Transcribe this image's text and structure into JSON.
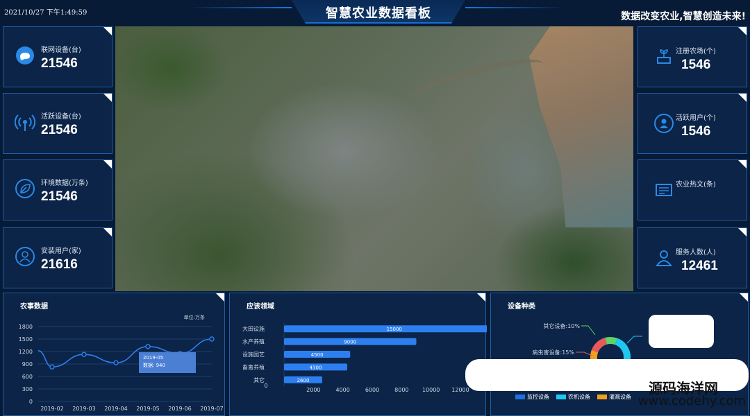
{
  "header": {
    "datetime": "2021/10/27 下午1:49:59",
    "title": "智慧农业数据看板",
    "slogan": "数据改变农业,智慧创造未来!"
  },
  "left_cards": [
    {
      "label": "联网设备(台)",
      "value": "21546",
      "icon": "cloud-chat-icon"
    },
    {
      "label": "活跃设备(台)",
      "value": "21546",
      "icon": "signal-tower-icon"
    },
    {
      "label": "环境数据(万条)",
      "value": "21546",
      "icon": "leaf-icon"
    },
    {
      "label": "安装用户(家)",
      "value": "21616",
      "icon": "user-icon"
    }
  ],
  "right_cards": [
    {
      "label": "注册农场(个)",
      "value": "1546",
      "icon": "plant-pot-icon"
    },
    {
      "label": "活跃用户(个)",
      "value": "1546",
      "icon": "user-group-icon"
    },
    {
      "label": "农业热文(条)",
      "value": "",
      "icon": "news-icon"
    },
    {
      "label": "服务人数(人)",
      "value": "12461",
      "icon": "person-icon"
    }
  ],
  "panels": {
    "farm": {
      "title": "农事数据",
      "unit": "单位:万条"
    },
    "apps": {
      "title": "应该领域"
    },
    "devices": {
      "title": "设备种类"
    }
  },
  "tooltip": {
    "line1": "2019-05",
    "line2": "数据: 940"
  },
  "watermark": {
    "cn": "源码海洋网",
    "en": "www.codehy.com"
  },
  "colors": {
    "accent": "#1e78dc",
    "panel": "#0b2447",
    "border": "#1f5fa8",
    "background": "#071a36"
  },
  "chart_data": [
    {
      "type": "line",
      "title": "农事数据",
      "x": [
        "2019-02",
        "2019-03",
        "2019-04",
        "2019-05",
        "2019-06",
        "2019-07"
      ],
      "series": [
        {
          "values": [
            830,
            1130,
            930,
            1320,
            1150,
            1500
          ]
        }
      ],
      "ylim": [
        0,
        1800
      ],
      "yticks": [
        0,
        300,
        600,
        900,
        1200,
        1500,
        1800
      ],
      "xlabel": "",
      "ylabel": "",
      "grid": true
    },
    {
      "type": "bar",
      "orientation": "horizontal",
      "title": "应该领域",
      "categories": [
        "大田设施",
        "水产养殖",
        "设施园艺",
        "畜禽养殖",
        "其它"
      ],
      "values": [
        15000,
        9000,
        4500,
        4300,
        2600
      ],
      "xticks": [
        0,
        2000,
        4000,
        6000,
        8000,
        10000,
        12000
      ],
      "xlim": [
        0,
        12000
      ]
    },
    {
      "type": "pie",
      "title": "设备种类",
      "labels": [
        "其它设备:10%",
        "病虫害设备:15%"
      ],
      "legend": [
        "监控设备",
        "农机设备",
        "灌溉设备"
      ],
      "legend_colors": [
        "#1f6fe0",
        "#1ec8f0",
        "#f0a020"
      ],
      "ring_colors": [
        "#1ec8f0",
        "#1f6fe0",
        "#f0a020",
        "#e85a5a",
        "#5fd36a"
      ],
      "ring_fractions": [
        0.45,
        0.15,
        0.15,
        0.15,
        0.1
      ]
    }
  ]
}
